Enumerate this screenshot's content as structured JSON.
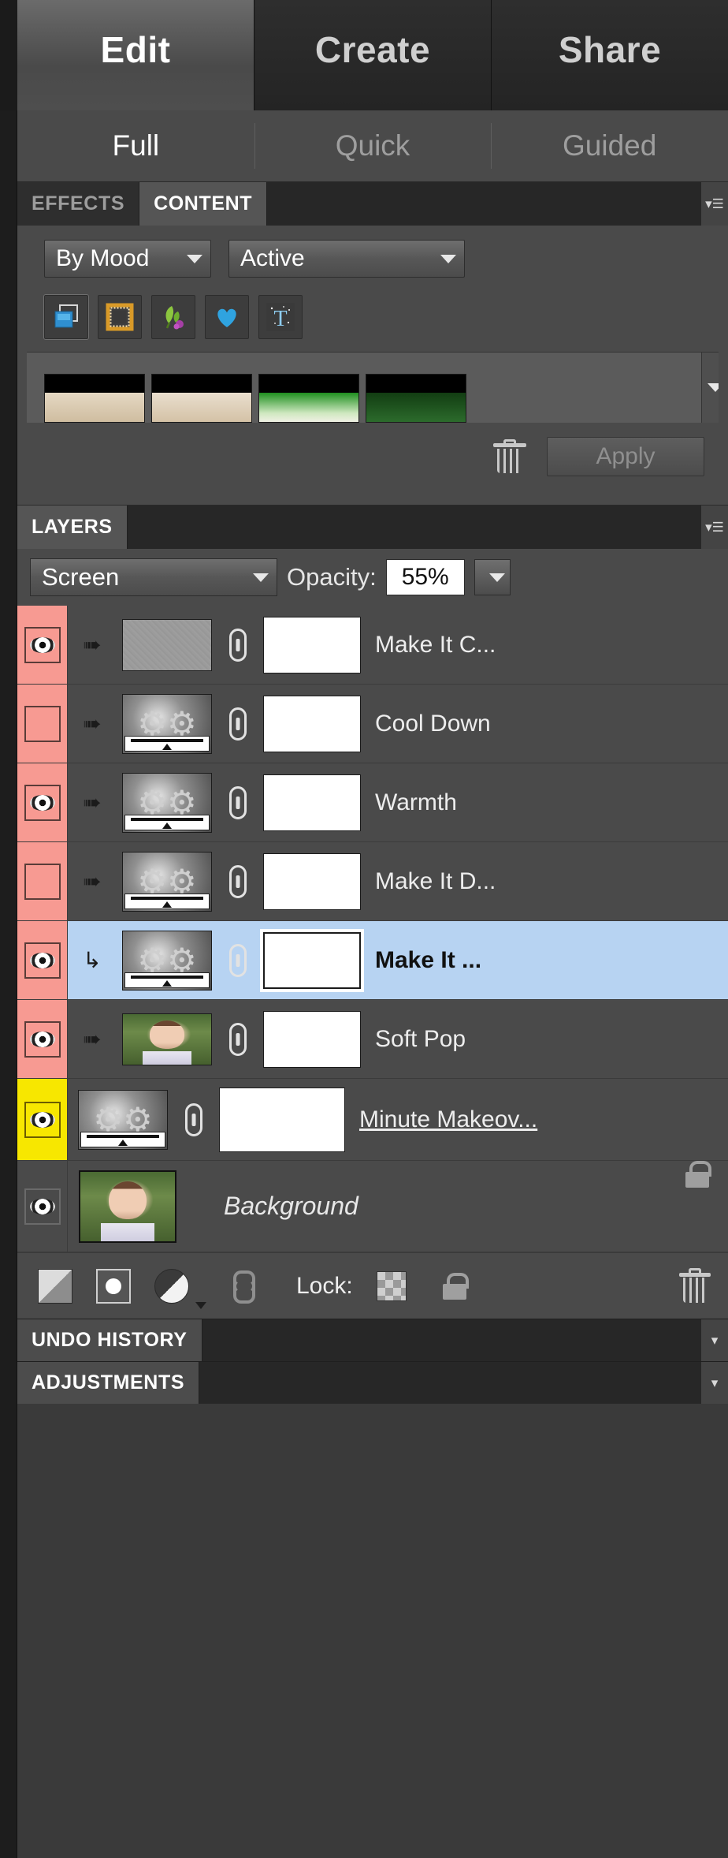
{
  "mode_tabs": [
    {
      "label": "Edit",
      "active": true
    },
    {
      "label": "Create",
      "active": false
    },
    {
      "label": "Share",
      "active": false
    }
  ],
  "sub_tabs": [
    {
      "label": "Full",
      "active": true
    },
    {
      "label": "Quick",
      "active": false
    },
    {
      "label": "Guided",
      "active": false
    }
  ],
  "content_panel": {
    "tabs": [
      {
        "label": "EFFECTS",
        "active": false
      },
      {
        "label": "CONTENT",
        "active": true
      }
    ],
    "filter_by": {
      "value": "By Mood",
      "icon": "chevron-down-icon"
    },
    "filter_value": {
      "value": "Active",
      "icon": "chevron-down-icon"
    },
    "category_icons": [
      {
        "name": "backgrounds-icon",
        "label": "Backgrounds"
      },
      {
        "name": "frames-icon",
        "label": "Frames"
      },
      {
        "name": "graphics-icon",
        "label": "Graphics"
      },
      {
        "name": "shapes-icon",
        "label": "Shapes"
      },
      {
        "name": "text-icon",
        "label": "Text"
      }
    ],
    "thumbnails": [
      {
        "name": "thumb-sand-1",
        "style": "g-sand"
      },
      {
        "name": "thumb-sand-2",
        "style": "g-sand2"
      },
      {
        "name": "thumb-green-1",
        "style": "g-green"
      },
      {
        "name": "thumb-green-2",
        "style": "g-dark"
      }
    ],
    "delete_icon": "trash-icon",
    "apply_label": "Apply"
  },
  "layers_panel": {
    "tab_label": "LAYERS",
    "blend_mode": "Screen",
    "blend_mode_caret": "chevron-down-icon",
    "opacity_label": "Opacity:",
    "opacity_value": "55%",
    "opacity_caret": "chevron-down-icon",
    "layers": [
      {
        "name": "Make It C...",
        "visible": true,
        "eye_highlight": "pink",
        "thumb_kind": "noise",
        "clipped": true,
        "selected": false,
        "has_mask": true,
        "mask_selected": false,
        "linked": true
      },
      {
        "name": "Cool Down",
        "visible": false,
        "eye_highlight": "pink",
        "thumb_kind": "adjustment",
        "clipped": true,
        "selected": false,
        "has_mask": true,
        "mask_selected": false,
        "linked": true
      },
      {
        "name": "Warmth",
        "visible": true,
        "eye_highlight": "pink",
        "thumb_kind": "adjustment",
        "clipped": true,
        "selected": false,
        "has_mask": true,
        "mask_selected": false,
        "linked": true
      },
      {
        "name": "Make It D...",
        "visible": false,
        "eye_highlight": "pink",
        "thumb_kind": "adjustment",
        "clipped": true,
        "selected": false,
        "has_mask": true,
        "mask_selected": false,
        "linked": true
      },
      {
        "name": "Make It ...",
        "visible": true,
        "eye_highlight": "pink",
        "thumb_kind": "adjustment",
        "clipped": true,
        "selected": true,
        "has_mask": true,
        "mask_selected": true,
        "linked": true
      },
      {
        "name": "Soft Pop",
        "visible": true,
        "eye_highlight": "pink",
        "thumb_kind": "photo",
        "clipped": true,
        "selected": false,
        "has_mask": true,
        "mask_selected": false,
        "linked": true
      },
      {
        "name": "Minute Makeov...",
        "visible": true,
        "eye_highlight": "yellow",
        "thumb_kind": "adjustment",
        "clipped": false,
        "selected": false,
        "has_mask": true,
        "mask_selected": false,
        "linked": true,
        "underlined": true
      }
    ],
    "background_layer": {
      "name": "Background",
      "visible": true,
      "locked": true,
      "lock_icon": "lock-icon"
    },
    "toolbar": {
      "new_layer_icon": "new-layer-icon",
      "mask_icon": "add-layer-mask-icon",
      "adjustment_icon": "new-adjustment-layer-icon",
      "adjustment_caret": "chevron-down-icon",
      "link_icon": "link-layers-icon",
      "lock_label": "Lock:",
      "lock_transparency_icon": "lock-transparency-checker-icon",
      "lock_all_icon": "lock-all-icon",
      "delete_icon": "trash-icon"
    }
  },
  "collapsed_panels": [
    {
      "label": "UNDO HISTORY"
    },
    {
      "label": "ADJUSTMENTS"
    }
  ],
  "colors": {
    "panel_bg": "#4a4a4a",
    "tabbar_bg": "#272727",
    "selected_row": "#b7d3f2",
    "eye_pink": "#f79a92",
    "eye_yellow": "#f7e700",
    "text": "#ededed"
  }
}
